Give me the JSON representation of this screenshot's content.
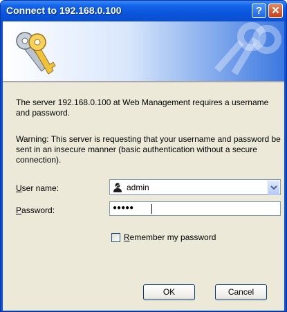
{
  "window": {
    "title": "Connect to 192.168.0.100"
  },
  "titlebar": {
    "help_label": "?",
    "close_label": "✕"
  },
  "message": {
    "line1": "The server 192.168.0.100 at Web Management requires a username and password.",
    "warning": "Warning: This server is requesting that your username and password be sent in an insecure manner (basic authentication without a secure connection)."
  },
  "form": {
    "username_label_accel": "U",
    "username_label_rest": "ser name:",
    "username_value": "admin",
    "password_label_accel": "P",
    "password_label_rest": "assword:",
    "password_value": "●●●●●",
    "remember_accel": "R",
    "remember_rest": "emember my password",
    "remember_checked": false
  },
  "buttons": {
    "ok": "OK",
    "cancel": "Cancel"
  },
  "icons": {
    "keys": "keys-icon",
    "user": "user-icon",
    "dropdown": "chevron-down-icon"
  },
  "colors": {
    "titlebar": "#0a55dc",
    "dialog_bg": "#ece9d8",
    "input_border": "#7f9db9"
  }
}
